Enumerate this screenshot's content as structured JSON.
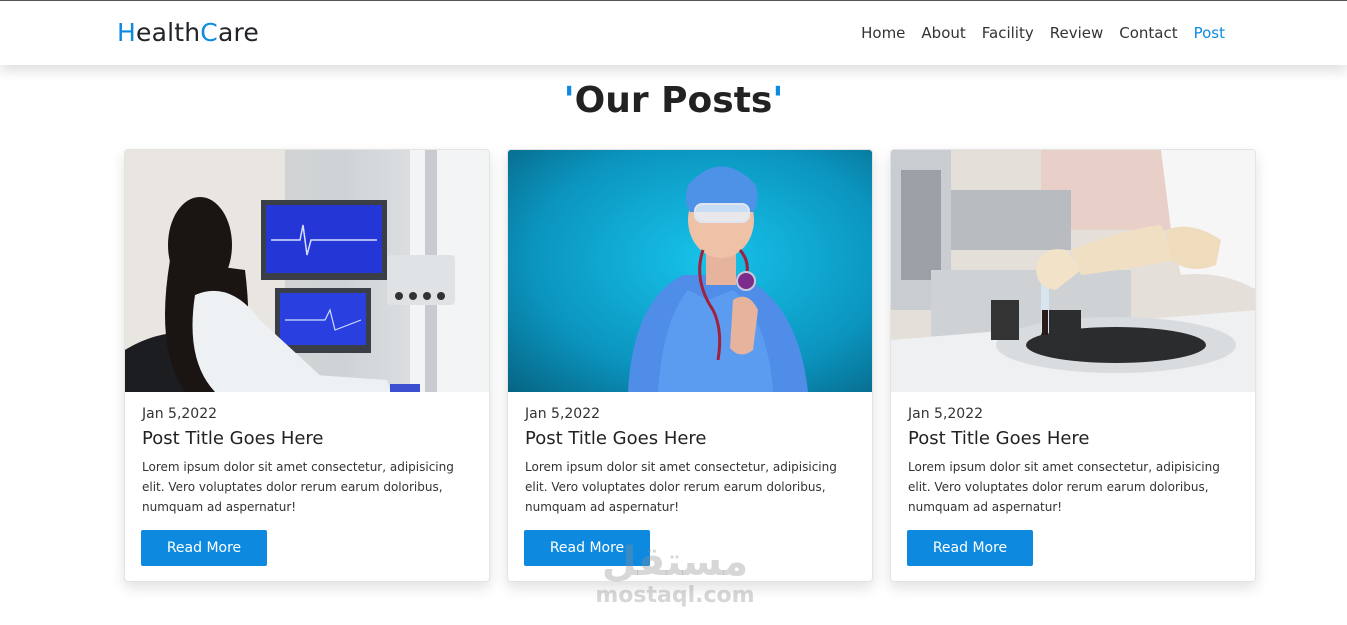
{
  "brand": {
    "h": "H",
    "ealth": "ealth",
    "c": "C",
    "are": "are"
  },
  "nav": {
    "items": [
      {
        "label": "Home"
      },
      {
        "label": "About"
      },
      {
        "label": "Facility"
      },
      {
        "label": "Review"
      },
      {
        "label": "Contact"
      },
      {
        "label": "Post"
      }
    ],
    "active": "Post"
  },
  "section": {
    "quote_open": "'",
    "title": "Our Posts",
    "quote_close": "'"
  },
  "posts": [
    {
      "date": "Jan 5,2022",
      "title": "Post Title Goes Here",
      "text": "Lorem ipsum dolor sit amet consectetur, adipisicing elit. Vero voluptates dolor rerum earum doloribus, numquam ad aspernatur!",
      "button": "Read More",
      "image": "doctor-at-monitors-photo"
    },
    {
      "date": "Jan 5,2022",
      "title": "Post Title Goes Here",
      "text": "Lorem ipsum dolor sit amet consectetur, adipisicing elit. Vero voluptates dolor rerum earum doloribus, numquam ad aspernatur!",
      "button": "Read More",
      "image": "nurse-with-stethoscope-photo"
    },
    {
      "date": "Jan 5,2022",
      "title": "Post Title Goes Here",
      "text": "Lorem ipsum dolor sit amet consectetur, adipisicing elit. Vero voluptates dolor rerum earum doloribus, numquam ad aspernatur!",
      "button": "Read More",
      "image": "lab-centrifuge-photo"
    }
  ],
  "watermark": {
    "arabic": "مستقل",
    "latin": "mostaql.com"
  },
  "colors": {
    "accent": "#0d8ae0",
    "text": "#212529"
  }
}
